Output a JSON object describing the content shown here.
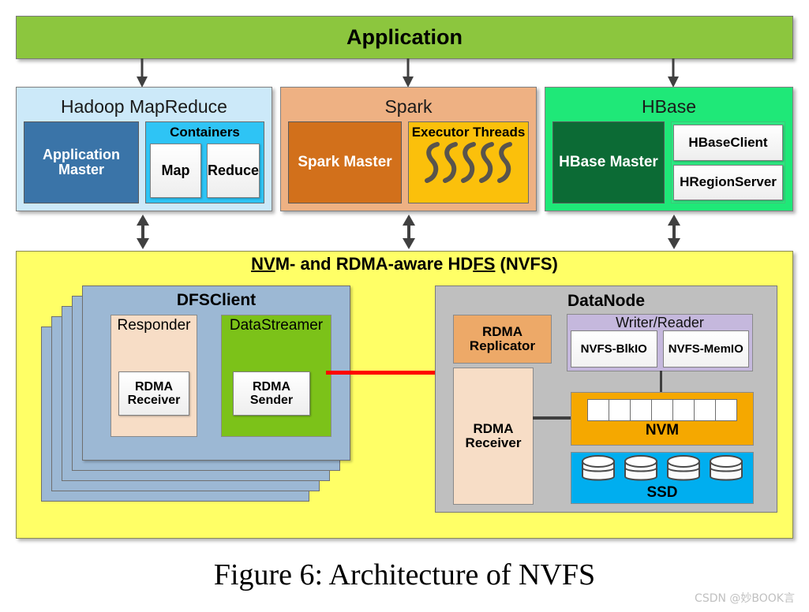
{
  "figure": {
    "caption": "Figure 6:  Architecture of NVFS",
    "watermark": "CSDN @妙BOOK言"
  },
  "application": {
    "label": "Application"
  },
  "frameworks": [
    {
      "title": "Hadoop MapReduce",
      "master_label": "Application Master",
      "group_label": "Containers",
      "chips": [
        "Map",
        "Reduce"
      ]
    },
    {
      "title": "Spark",
      "master_label": "Spark Master",
      "group_label": "Executor Threads",
      "threads_count": 5
    },
    {
      "title": "HBase",
      "master_label": "HBase Master",
      "chips": [
        "HBaseClient",
        "HRegionServer"
      ]
    }
  ],
  "nvfs": {
    "title_part1": "NV",
    "title_part2": "M- and RDMA-aware HD",
    "title_part3": "FS",
    "title_part4": " (NVFS)",
    "dfsclient": {
      "title": "DFSClient",
      "stack_layers": 5,
      "responder": {
        "label": "Responder",
        "chip": "RDMA Receiver"
      },
      "datastreamer": {
        "label": "DataStreamer",
        "chip": "RDMA Sender"
      }
    },
    "datanode": {
      "title": "DataNode",
      "rdma_replicator": "RDMA Replicator",
      "rdma_receiver": "RDMA Receiver",
      "writer_reader": {
        "label": "Writer/Reader",
        "chips": [
          "NVFS-BlkIO",
          "NVFS-MemIO"
        ]
      },
      "nvm": {
        "label": "NVM",
        "cells": 7
      },
      "ssd": {
        "label": "SSD",
        "disks": 4
      }
    }
  },
  "colors": {
    "application": "#8cc63e",
    "hadoop": "#cce9f9",
    "spark": "#eeb183",
    "hbase": "#1fe878",
    "nvfs_panel": "#ffff66",
    "dfsclient": "#9cb8d4",
    "datanode": "#bfbfbf",
    "nvm": "#f5a800",
    "ssd": "#00aeef",
    "link": "#ff0000"
  }
}
